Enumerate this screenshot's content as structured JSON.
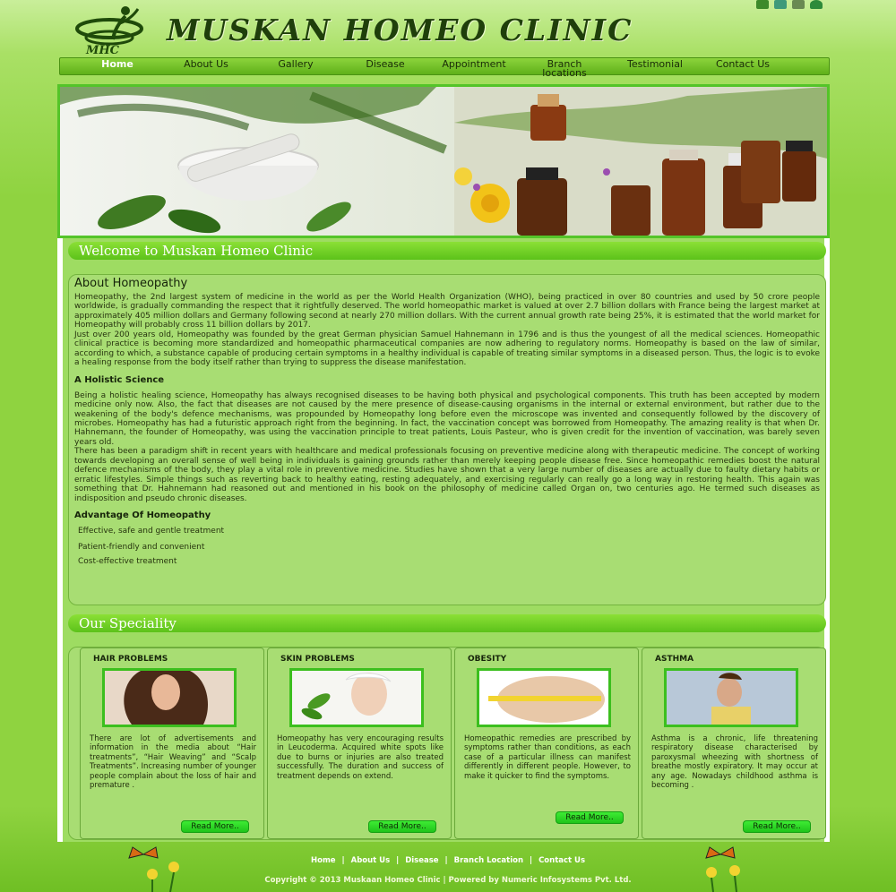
{
  "social": [
    "facebook-icon",
    "twitter-icon",
    "email-icon",
    "user-icon"
  ],
  "header": {
    "logo_text": "MHC",
    "title": "MUSKAN HOMEO CLINIC"
  },
  "nav": [
    {
      "label": "Home",
      "active": true
    },
    {
      "label": "About Us"
    },
    {
      "label": "Gallery"
    },
    {
      "label": "Disease"
    },
    {
      "label": "Appointment"
    },
    {
      "label": "Branch locations"
    },
    {
      "label": "Testimonial"
    },
    {
      "label": "Contact Us"
    }
  ],
  "welcome": "Welcome to Muskan Homeo Clinic",
  "about": {
    "title": "About Homeopathy",
    "p1": "Homeopathy, the 2nd largest system of medicine in the world as per the World Health Organization (WHO), being practiced in over 80 countries and used by 50 crore people worldwide, is gradually commanding the respect that it rightfully deserved. The world homeopathic market is valued at over 2.7 billion dollars with France being the largest market at approximately 405 million dollars and Germany following second at nearly 270 million dollars. With the current annual growth rate being 25%, it is estimated that the world market for Homeopathy will probably cross 11 billion dollars by 2017.",
    "p2": "Just over 200 years old, Homeopathy was founded by the great German physician Samuel Hahnemann in 1796 and is thus the youngest of all the medical sciences. Homeopathic clinical practice is becoming more standardized and homeopathic pharmaceutical companies are now adhering to regulatory norms. Homeopathy is based on the law of similar, according to which, a substance capable of producing certain symptoms in a healthy individual is capable of treating similar symptoms in a diseased person. Thus, the logic is to evoke a healing response from the body itself rather than trying to suppress the disease manifestation.",
    "holistic_title": "A Holistic Science",
    "p3": "Being a holistic healing science, Homeopathy has always recognised diseases to be having both physical and psychological components. This truth has been accepted by modern medicine only now. Also, the fact that diseases are not caused by the mere presence of disease-causing organisms in the internal or external environment, but rather due to the weakening of the body's defence mechanisms, was propounded by Homeopathy long before even the microscope was invented and consequently followed by the discovery of microbes. Homeopathy has had a futuristic approach right from the beginning. In fact, the vaccination concept was borrowed from Homeopathy. The amazing reality is that when Dr. Hahnemann, the founder of Homeopathy, was using the vaccination principle to treat patients, Louis Pasteur, who is given credit for the invention of vaccination, was barely seven years old.",
    "p4": "There has been a paradigm shift in recent years with healthcare and medical professionals focusing on preventive medicine along with therapeutic medicine. The concept of working towards developing an overall sense of well being in individuals is gaining grounds rather than merely keeping people disease free. Since homeopathic remedies boost the natural defence mechanisms of the body, they play a vital role in preventive medicine. Studies have shown that a very large number of diseases are actually due to faulty dietary habits or erratic lifestyles. Simple things such as reverting back to healthy eating, resting adequately, and exercising regularly can really go a long way in restoring health. This again was something that Dr. Hahnemann had reasoned out and mentioned in his book on the philosophy of medicine called Organ on, two centuries ago. He termed such diseases as indisposition and pseudo chronic diseases.",
    "advantage_title": "Advantage Of Homeopathy",
    "advantages": [
      "Effective, safe and gentle treatment",
      "Patient-friendly and convenient",
      "Cost-effective treatment"
    ]
  },
  "speciality": {
    "title": "Our Speciality",
    "cards": [
      {
        "title": "HAIR PROBLEMS",
        "text": "There are lot of advertisements and information in the media about “Hair treatments”, “Hair Weaving” and “Scalp Treatments”. Increasing number of younger people complain about the loss of hair and premature .",
        "button": "Read More.."
      },
      {
        "title": "SKIN PROBLEMS",
        "text": "Homeopathy has very encouraging results in Leucoderma. Acquired white spots like due to burns or injuries are also treated successfully. The duration and success of treatment depends on extend.",
        "button": "Read More.."
      },
      {
        "title": "OBESITY",
        "text": "Homeopathic remedies are prescribed by symptoms rather than conditions, as each case of a particular illness can manifest differently in different people. However, to make it quicker to find the symptoms.",
        "button": "Read More.."
      },
      {
        "title": "ASTHMA",
        "text": "Asthma is a chronic, life threatening respiratory disease characterised by paroxysmal wheezing with shortness of breathe mostly expiratory. It may occur at any age. Nowadays childhood asthma is becoming .",
        "button": "Read More.."
      }
    ]
  },
  "footer": {
    "links": [
      "Home",
      "About Us",
      "Disease",
      "Branch Location",
      "Contact Us"
    ],
    "separator": "|",
    "copyright": "Copyright © 2013 Muskaan Homeo Clinic | Powered by Numeric Infosystems Pvt. Ltd."
  }
}
